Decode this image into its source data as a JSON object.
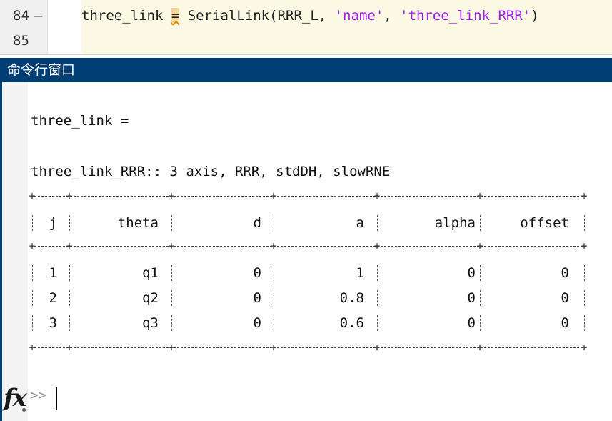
{
  "editor": {
    "lines": [
      {
        "number": "84",
        "marker": "—",
        "code_prefix": "three_link ",
        "code_eq": "=",
        "code_mid": " SerialLink(RRR_L, ",
        "str1": "'name'",
        "code_comma": ", ",
        "str2": "'three_link_RRR'",
        "code_end": ")"
      },
      {
        "number": "85",
        "marker": "",
        "code_prefix": "",
        "code_eq": "",
        "code_mid": "",
        "str1": "",
        "code_comma": "",
        "str2": "",
        "code_end": ""
      }
    ]
  },
  "command_window": {
    "title": "命令行窗口",
    "output_var": "three_link =",
    "robot_summary": "three_link_RRR:: 3 axis, RRR, stdDH, slowRNE",
    "table": {
      "headers": [
        "j",
        "theta",
        "d",
        "a",
        "alpha",
        "offset"
      ],
      "rows": [
        [
          "1",
          "q1",
          "0",
          "1",
          "0",
          "0"
        ],
        [
          "2",
          "q2",
          "0",
          "0.8",
          "0",
          "0"
        ],
        [
          "3",
          "q3",
          "0",
          "0.6",
          "0",
          "0"
        ]
      ]
    },
    "prompt_icon": "fx",
    "prompt": ">>"
  },
  "colors": {
    "title_bar": "#003e73",
    "string_literal": "#a020f0",
    "editor_highlight": "#fbf9e3"
  }
}
